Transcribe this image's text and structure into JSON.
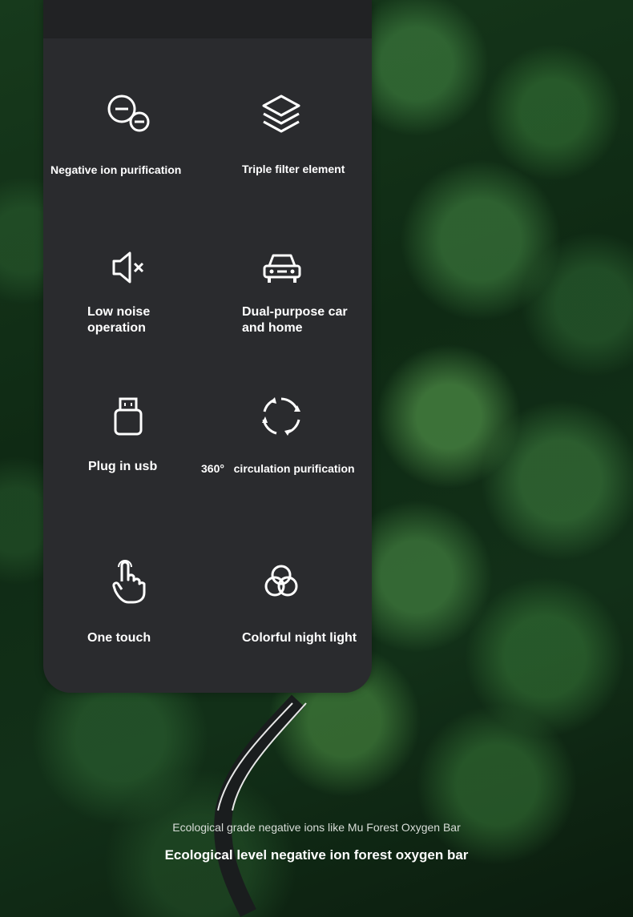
{
  "features": [
    {
      "icon": "minus-circles-icon",
      "label": "Negative ion purification"
    },
    {
      "icon": "layers-icon",
      "label": "Triple filter element"
    },
    {
      "icon": "mute-speaker-icon",
      "label_lines": [
        "Low noise",
        "operation"
      ]
    },
    {
      "icon": "car-icon",
      "label_lines": [
        "Dual-purpose car",
        "and home"
      ]
    },
    {
      "icon": "usb-icon",
      "label": "Plug in usb"
    },
    {
      "icon": "circulation-icon",
      "label_degree": "360°",
      "label_rest": "circulation purification"
    },
    {
      "icon": "touch-hand-icon",
      "label": "One touch"
    },
    {
      "icon": "color-circles-icon",
      "label": "Colorful night light"
    }
  ],
  "captions": {
    "sub": "Ecological grade negative ions like Mu Forest Oxygen Bar",
    "main": "Ecological level negative ion forest oxygen bar"
  }
}
